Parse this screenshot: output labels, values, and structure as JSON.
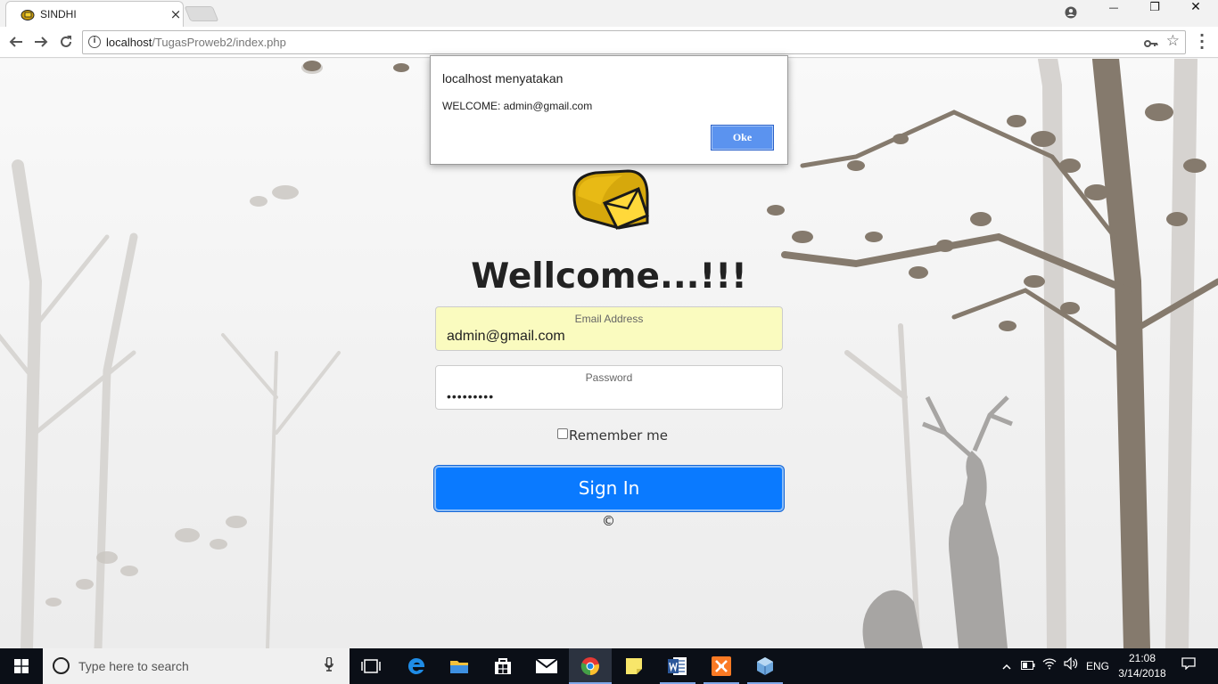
{
  "browser": {
    "tab": {
      "title": "SINDHI",
      "close_glyph": "×"
    },
    "window_controls": {
      "account": "account-icon",
      "minimize": "—",
      "restore": "❐",
      "close": "✕"
    },
    "address_bar": {
      "host": "localhost",
      "path": "/TugasProweb2/index.php"
    }
  },
  "page": {
    "heading": "Wellcome...!!!",
    "email": {
      "label": "Email Address",
      "value": "admin@gmail.com"
    },
    "password": {
      "label": "Password",
      "value": "•••••••••"
    },
    "remember_label": "Remember me",
    "signin_label": "Sign In",
    "copyright": "©"
  },
  "dialog": {
    "title": "localhost menyatakan",
    "message": "WELCOME: admin@gmail.com",
    "ok_label": "Oke"
  },
  "taskbar": {
    "search_placeholder": "Type here to search",
    "apps": [
      "task-view-icon",
      "edge-icon",
      "file-explorer-icon",
      "store-icon",
      "mail-icon",
      "chrome-icon",
      "sticky-notes-icon",
      "word-icon",
      "xampp-icon",
      "virtualbox-icon"
    ],
    "language": "ENG",
    "time": "21:08",
    "date": "3/14/2018"
  },
  "colors": {
    "accent": "#0a7aff",
    "autofill": "#fafbbf",
    "dialog_button": "#5b93ef",
    "taskbar": "#0b0f17"
  }
}
